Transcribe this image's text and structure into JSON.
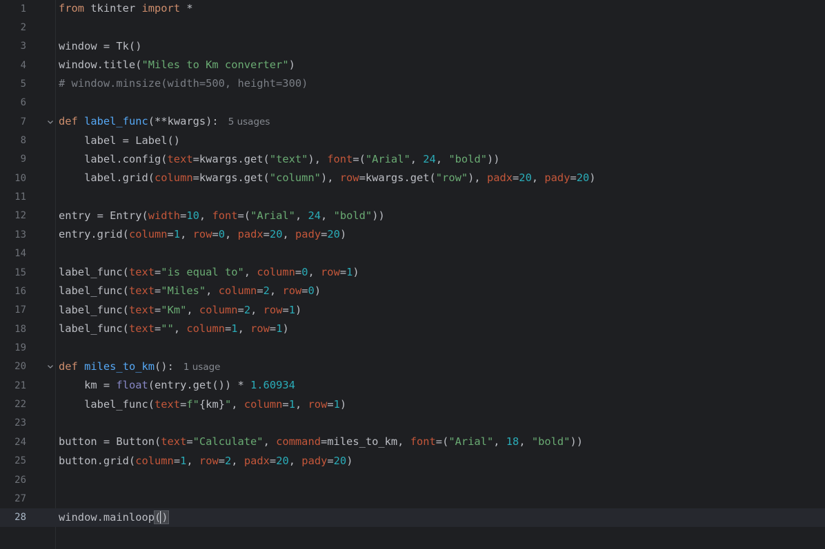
{
  "editor": {
    "current_line": 28,
    "colors": {
      "background": "#1e1f22",
      "current_line": "#26282e",
      "keyword": "#cf8e6d",
      "string": "#6aab73",
      "number": "#2aacb8",
      "param": "#c5573a",
      "function": "#56a8f5",
      "comment": "#7a7e85"
    },
    "lines": [
      {
        "no": "1"
      },
      {
        "no": "2"
      },
      {
        "no": "3"
      },
      {
        "no": "4"
      },
      {
        "no": "5"
      },
      {
        "no": "6"
      },
      {
        "no": "7"
      },
      {
        "no": "8"
      },
      {
        "no": "9"
      },
      {
        "no": "10"
      },
      {
        "no": "11"
      },
      {
        "no": "12"
      },
      {
        "no": "13"
      },
      {
        "no": "14"
      },
      {
        "no": "15"
      },
      {
        "no": "16"
      },
      {
        "no": "17"
      },
      {
        "no": "18"
      },
      {
        "no": "19"
      },
      {
        "no": "20"
      },
      {
        "no": "21"
      },
      {
        "no": "22"
      },
      {
        "no": "23"
      },
      {
        "no": "24"
      },
      {
        "no": "25"
      },
      {
        "no": "26"
      },
      {
        "no": "27"
      },
      {
        "no": "28"
      }
    ],
    "hints": {
      "label_func_usages": "5 usages",
      "miles_to_km_usages": "1 usage"
    },
    "code": {
      "l1": {
        "kw1": "from",
        "mod": " tkinter ",
        "kw2": "import",
        "rest": " *"
      },
      "l3": "window = Tk()",
      "l4": {
        "a": "window.title(",
        "s": "\"Miles to Km converter\"",
        "b": ")"
      },
      "l5": "# window.minsize(width=500, height=300)",
      "l7": {
        "kw": "def",
        "fn": "label_func",
        "rest": "(**kwargs):"
      },
      "l8": "    label = Label()",
      "l9": {
        "a": "    label.config(",
        "p1": "text",
        "b": "=kwargs.get(",
        "s1": "\"text\"",
        "c": "), ",
        "p2": "font",
        "d": "=(",
        "s2": "\"Arial\"",
        "e": ", ",
        "n1": "24",
        "f": ", ",
        "s3": "\"bold\"",
        "g": "))"
      },
      "l10": {
        "a": "    label.grid(",
        "p1": "column",
        "b": "=kwargs.get(",
        "s1": "\"column\"",
        "c": "), ",
        "p2": "row",
        "d": "=kwargs.get(",
        "s2": "\"row\"",
        "e": "), ",
        "p3": "padx",
        "f": "=",
        "n1": "20",
        "g": ", ",
        "p4": "pady",
        "h": "=",
        "n2": "20",
        "i": ")"
      },
      "l12": {
        "a": "entry = Entry(",
        "p1": "width",
        "b": "=",
        "n1": "10",
        "c": ", ",
        "p2": "font",
        "d": "=(",
        "s1": "\"Arial\"",
        "e": ", ",
        "n2": "24",
        "f": ", ",
        "s2": "\"bold\"",
        "g": "))"
      },
      "l13": {
        "a": "entry.grid(",
        "p1": "column",
        "b": "=",
        "n1": "1",
        "c": ", ",
        "p2": "row",
        "d": "=",
        "n2": "0",
        "e": ", ",
        "p3": "padx",
        "f": "=",
        "n3": "20",
        "g": ", ",
        "p4": "pady",
        "h": "=",
        "n4": "20",
        "i": ")"
      },
      "l15": {
        "a": "label_func(",
        "p1": "text",
        "b": "=",
        "s1": "\"is equal to\"",
        "c": ", ",
        "p2": "column",
        "d": "=",
        "n1": "0",
        "e": ", ",
        "p3": "row",
        "f": "=",
        "n2": "1",
        "g": ")"
      },
      "l16": {
        "a": "label_func(",
        "p1": "text",
        "b": "=",
        "s1": "\"Miles\"",
        "c": ", ",
        "p2": "column",
        "d": "=",
        "n1": "2",
        "e": ", ",
        "p3": "row",
        "f": "=",
        "n2": "0",
        "g": ")"
      },
      "l17": {
        "a": "label_func(",
        "p1": "text",
        "b": "=",
        "s1": "\"Km\"",
        "c": ", ",
        "p2": "column",
        "d": "=",
        "n1": "2",
        "e": ", ",
        "p3": "row",
        "f": "=",
        "n2": "1",
        "g": ")"
      },
      "l18": {
        "a": "label_func(",
        "p1": "text",
        "b": "=",
        "s1": "\"\"",
        "c": ", ",
        "p2": "column",
        "d": "=",
        "n1": "1",
        "e": ", ",
        "p3": "row",
        "f": "=",
        "n2": "1",
        "g": ")"
      },
      "l20": {
        "kw": "def",
        "fn": "miles_to_km",
        "rest": "():"
      },
      "l21": {
        "a": "    km = ",
        "bi": "float",
        "b": "(entry.get()) * ",
        "n1": "1.60934"
      },
      "l22": {
        "a": "    label_func(",
        "p1": "text",
        "b": "=",
        "s1": "f\"",
        "c": "{km}",
        "s2": "\"",
        "d": ", ",
        "p2": "column",
        "e": "=",
        "n1": "1",
        "f": ", ",
        "p3": "row",
        "g": "=",
        "n2": "1",
        "h": ")"
      },
      "l24": {
        "a": "button = Button(",
        "p1": "text",
        "b": "=",
        "s1": "\"Calculate\"",
        "c": ", ",
        "p2": "command",
        "d": "=miles_to_km, ",
        "p3": "font",
        "e": "=(",
        "s2": "\"Arial\"",
        "f": ", ",
        "n1": "18",
        "g": ", ",
        "s3": "\"bold\"",
        "h": "))"
      },
      "l25": {
        "a": "button.grid(",
        "p1": "column",
        "b": "=",
        "n1": "1",
        "c": ", ",
        "p2": "row",
        "d": "=",
        "n2": "2",
        "e": ", ",
        "p3": "padx",
        "f": "=",
        "n3": "20",
        "g": ", ",
        "p4": "pady",
        "h": "=",
        "n4": "20",
        "i": ")"
      },
      "l28": {
        "a": "window.mainloop",
        "paren_open": "(",
        "paren_close": ")"
      }
    }
  }
}
